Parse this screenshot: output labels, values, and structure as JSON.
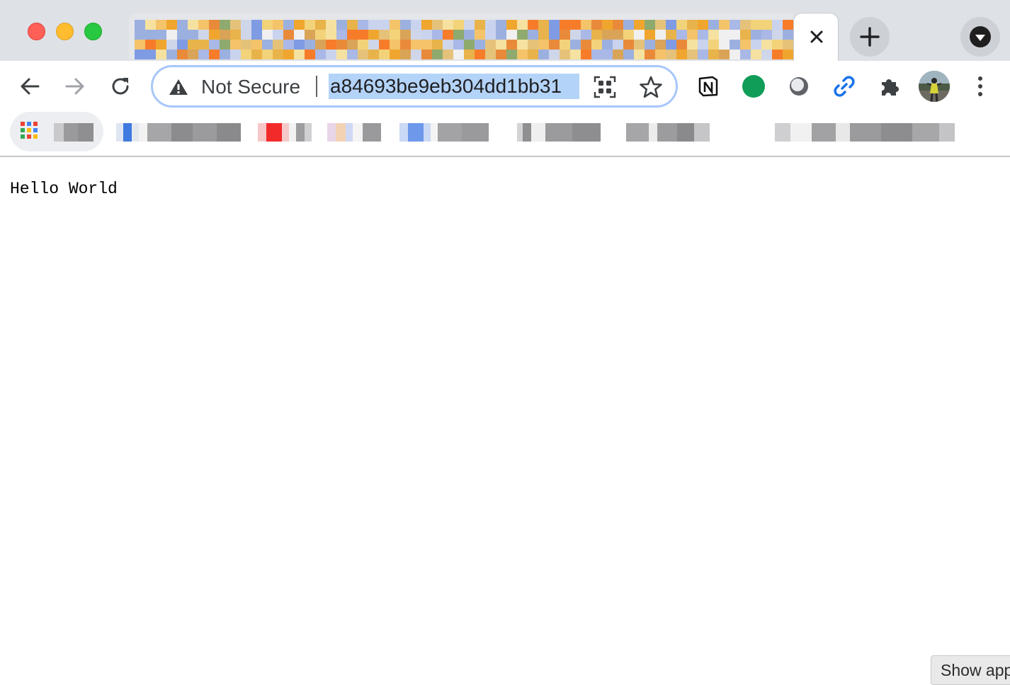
{
  "browser": {
    "address_bar": {
      "security_label": "Not Secure",
      "url": "a84693be9eb304dd1bb31"
    }
  },
  "page": {
    "body_text": "Hello World"
  },
  "overlay": {
    "show_apps_label": "Show app"
  },
  "icons": {
    "tab_close": "close-icon",
    "new_tab": "plus-icon",
    "tab_search": "chevron-down-circle-icon",
    "back": "arrow-left-icon",
    "forward": "arrow-right-icon",
    "reload": "reload-icon",
    "security": "warning-triangle-icon",
    "qr": "qr-code-icon",
    "bookmark": "star-icon",
    "extensions": [
      "notion-icon",
      "green-circle-icon",
      "gray-ring-icon",
      "link-icon",
      "puzzle-icon"
    ],
    "profile": "avatar",
    "menu": "kebab-menu-icon"
  },
  "colors": {
    "tabstrip_bg": "#dee1e6",
    "omnibox_border": "#a8c7fa",
    "url_selection": "#b4d3f8",
    "link_icon": "#1a73e8",
    "green_ext": "#0f9d58"
  }
}
